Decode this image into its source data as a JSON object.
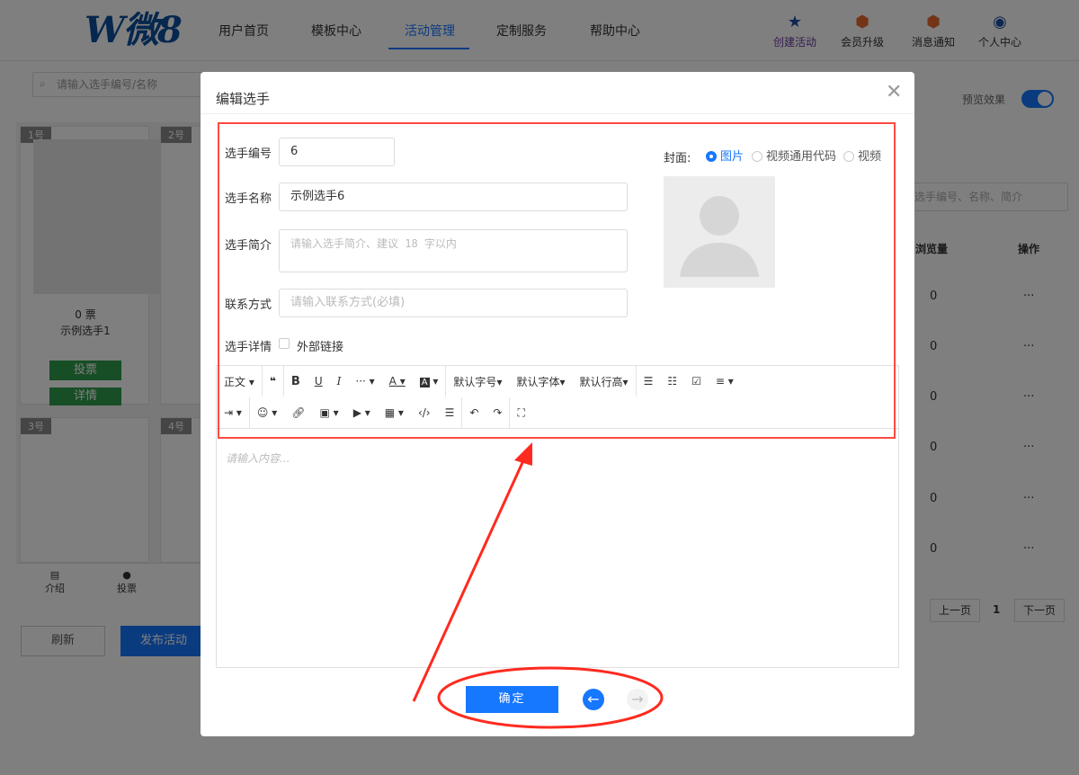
{
  "nav": {
    "logo_text": "W微8",
    "items": [
      "用户首页",
      "模板中心",
      "活动管理",
      "定制服务",
      "帮助中心"
    ],
    "active": "活动管理",
    "right_items": [
      "创建活动",
      "会员升级",
      "消息通知",
      "个人中心"
    ]
  },
  "background": {
    "search_placeholder": "请输入选手编号/名称",
    "preview_label": "预览效果",
    "cards": [
      {
        "tag": "1号",
        "votes": "0 票",
        "name": "示例选手1",
        "vote_btn": "投票",
        "detail_btn": "详情"
      },
      {
        "tag": "2号"
      },
      {
        "tag": "3号"
      },
      {
        "tag": "4号"
      }
    ],
    "bottom_tabs": [
      "介绍",
      "投票"
    ],
    "refresh_btn": "刷新",
    "publish_btn": "发布活动",
    "right_search_placeholder": "选手编号、名称、简介",
    "table_headers": [
      "浏览量",
      "操作"
    ],
    "table_rows": [
      {
        "views": "0",
        "ops": "···"
      },
      {
        "views": "0",
        "ops": "···"
      },
      {
        "views": "0",
        "ops": "···"
      },
      {
        "views": "0",
        "ops": "···"
      },
      {
        "views": "0",
        "ops": "···"
      },
      {
        "views": "0",
        "ops": "···"
      }
    ],
    "pagination": {
      "prev": "上一页",
      "page": "1",
      "next": "下一页"
    }
  },
  "modal": {
    "title": "编辑选手",
    "number_label": "选手编号",
    "number_value": "6",
    "name_label": "选手名称",
    "name_value": "示例选手6",
    "intro_label": "选手简介",
    "intro_placeholder": "请输入选手简介、建议 18 字以内",
    "contact_label": "联系方式",
    "contact_placeholder": "请输入联系方式(必填)",
    "details_label": "选手详情",
    "external_link_label": "外部链接",
    "cover_label": "封面:",
    "cover_options": [
      "图片",
      "视频通用代码",
      "视频"
    ],
    "cover_selected": "图片",
    "toolbar_row1": [
      "正文",
      "❝",
      "B",
      "U",
      "I",
      "···",
      "A",
      "A",
      "默认字号",
      "默认字体",
      "默认行高"
    ],
    "editor_placeholder": "请输入内容...",
    "confirm_btn": "确定"
  }
}
